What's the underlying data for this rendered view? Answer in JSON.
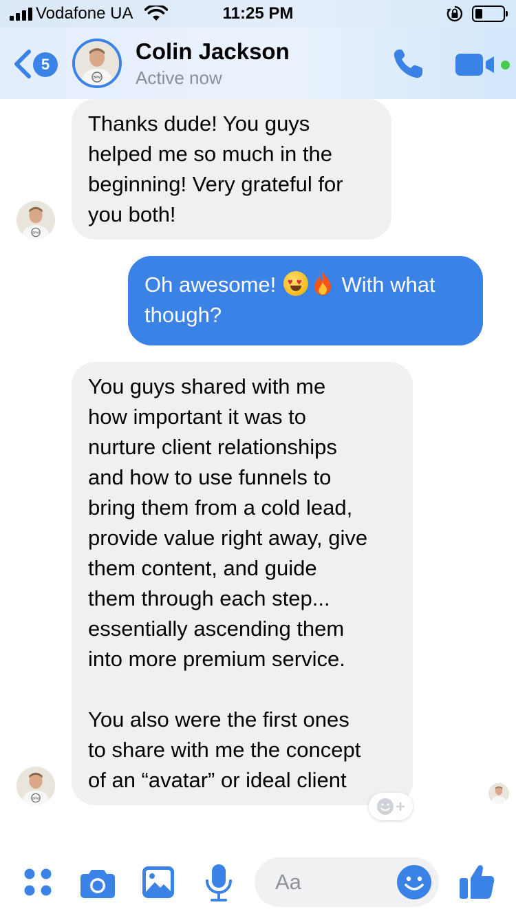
{
  "status_bar": {
    "carrier": "Vodafone UA",
    "time": "11:25 PM"
  },
  "header": {
    "back_badge": "5",
    "contact_name": "Colin Jackson",
    "contact_status": "Active now",
    "avatar_shirt_text": "BPM"
  },
  "messages": [
    {
      "direction": "incoming",
      "text": "Thanks dude! You guys\nhelped me so much in the\nbeginning! Very grateful for\nyou both!"
    },
    {
      "direction": "outgoing",
      "text_before": "Oh awesome! ",
      "emojis": [
        "heart-eyes-emoji",
        "fire-emoji"
      ],
      "text_after": " With what\nthough?"
    },
    {
      "direction": "incoming",
      "text": "You guys shared with me\nhow important it was to\nnurture client relationships\nand how to use funnels to\nbring them from a cold lead,\nprovide value right away, give\nthem content, and guide\nthem through each step...\nessentially ascending them\ninto more premium service.\n\nYou also were the first ones\nto share with me the concept\nof an “avatar” or ideal client"
    }
  ],
  "composer": {
    "placeholder": "Aa",
    "icons": [
      "apps-icon",
      "camera-icon",
      "gallery-icon",
      "microphone-icon",
      "emoji-icon",
      "like-icon"
    ]
  },
  "colors": {
    "accent": "#3b82e6",
    "incoming_bubble": "#f0f0f0",
    "online": "#47c94b"
  }
}
